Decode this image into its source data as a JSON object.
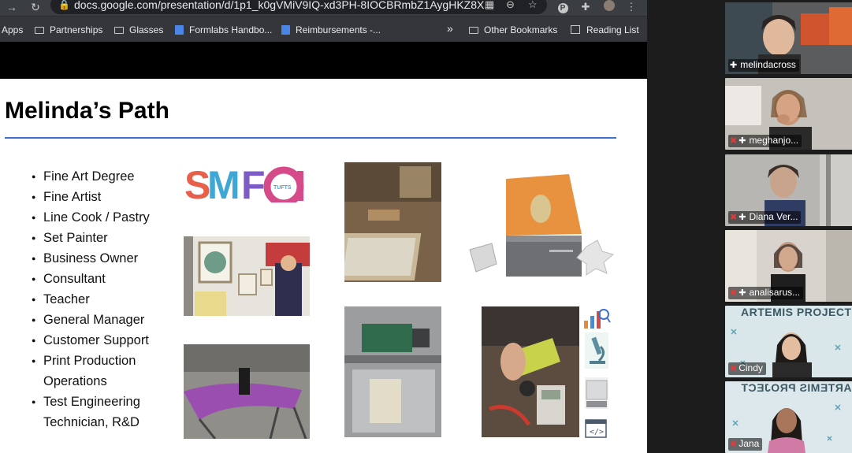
{
  "browser": {
    "url": "docs.google.com/presentation/d/1p1_k0gVMiV9IQ-xd3PH-8IOCBRmbZ1AygHKZ8X...",
    "bookmarks": [
      {
        "label": "Apps",
        "kind": "apps"
      },
      {
        "label": "Partnerships",
        "kind": "folder"
      },
      {
        "label": "Glasses",
        "kind": "folder"
      },
      {
        "label": "Formlabs Handbo...",
        "kind": "doc"
      },
      {
        "label": "Reimbursements -...",
        "kind": "doc"
      }
    ],
    "overflow_label": "»",
    "other_bookmarks": "Other Bookmarks",
    "reading_list": "Reading List"
  },
  "slide": {
    "title": "Melinda’s Path",
    "bullets": [
      "Fine Art Degree",
      "Fine Artist",
      "Line Cook / Pastry",
      "Set Painter",
      "Business Owner",
      "Consultant",
      "Teacher",
      "General Manager",
      "Customer Support",
      "Print Production\nOperations",
      "Test Engineering\nTechnician, R&D"
    ],
    "smfa_logo": "SMFA",
    "smfa_sub": "TUFTS"
  },
  "participants": [
    {
      "name": "melindacross",
      "muted": false,
      "active": true
    },
    {
      "name": "meghanjo...",
      "muted": true,
      "active": false
    },
    {
      "name": "Diana Ver...",
      "muted": true,
      "active": false
    },
    {
      "name": "analisarus...",
      "muted": true,
      "active": false
    },
    {
      "name": "Cindy",
      "muted": true,
      "active": false,
      "banner": "ARTEMIS PROJECT"
    },
    {
      "name": "Jana",
      "muted": true,
      "active": false,
      "banner": "ARTEMIS PROJECT"
    }
  ],
  "colors": {
    "accent_rule": "#3f6fd0",
    "active_speaker": "#d7e44a",
    "muted": "#e23b3b"
  }
}
